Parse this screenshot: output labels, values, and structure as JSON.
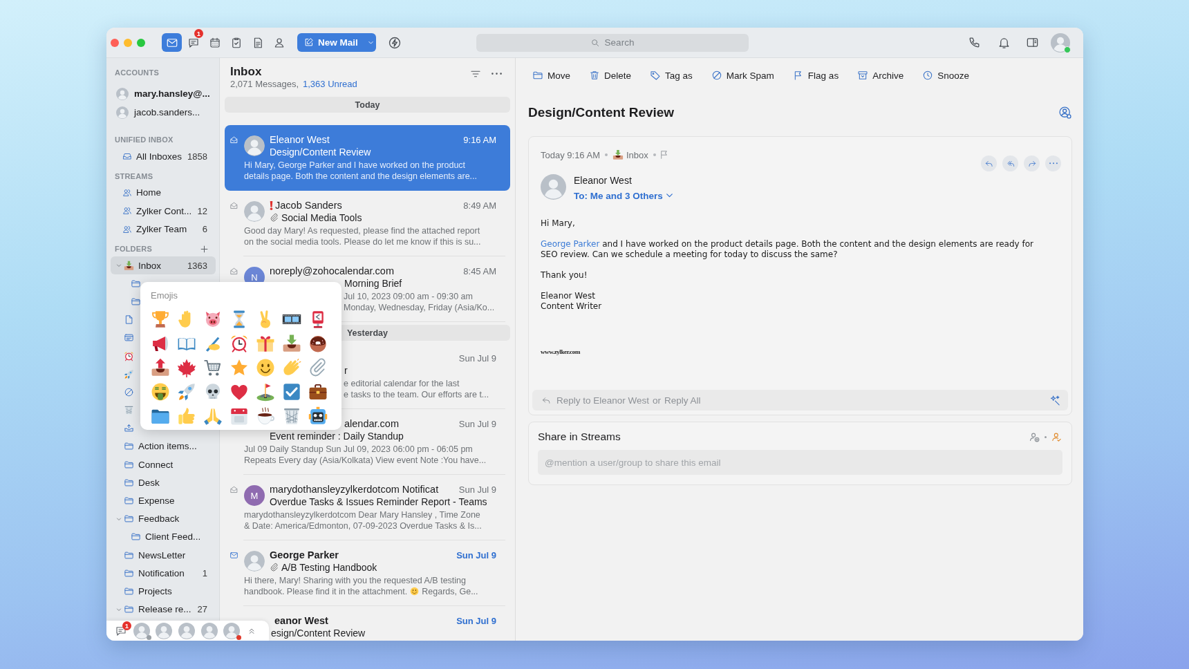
{
  "toolbar": {
    "apps": [
      {
        "kind": "mail",
        "selected": true
      },
      {
        "kind": "chat",
        "selected": false,
        "badge": "1"
      },
      {
        "kind": "calendar",
        "selected": false
      },
      {
        "kind": "tasks",
        "selected": false
      },
      {
        "kind": "notes",
        "selected": false
      },
      {
        "kind": "contacts",
        "selected": false
      }
    ],
    "new_mail": "New Mail",
    "search": {
      "placeholder": "Search"
    },
    "profile": {
      "color": "#35c759"
    }
  },
  "sidebar": {
    "sections": [
      {
        "title": "ACCOUNTS",
        "items": [
          {
            "kind": "account",
            "label": "mary.hansley@...",
            "primary": true,
            "selected": false
          },
          {
            "kind": "account",
            "label": "jacob.sanders...",
            "primary": false,
            "selected": false
          }
        ]
      },
      {
        "title": "UNIFIED INBOX",
        "items": [
          {
            "kind": "all_inboxes",
            "label": "All Inboxes",
            "count": "1858",
            "selected": false
          }
        ]
      },
      {
        "title": "STREAMS",
        "items": [
          {
            "kind": "stream",
            "label": "Home",
            "selected": false
          },
          {
            "kind": "stream",
            "label": "Zylker Cont...",
            "count": "12",
            "selected": false
          },
          {
            "kind": "stream",
            "label": "Zylker Team",
            "count": "6",
            "selected": false
          }
        ]
      },
      {
        "title": "FOLDERS",
        "add_button": true,
        "items": [
          {
            "kind": "inbox",
            "label": "Inbox",
            "count": "1363",
            "expanded": true,
            "selected": true,
            "children": [
              {
                "kind": "folder",
                "selected": false
              },
              {
                "kind": "folder",
                "selected": false
              }
            ]
          },
          {
            "kind": "drafts",
            "selected": false
          },
          {
            "kind": "templates",
            "selected": false
          },
          {
            "kind": "snoozed",
            "selected": false
          },
          {
            "kind": "sent",
            "selected": false
          },
          {
            "kind": "spam",
            "selected": false
          },
          {
            "kind": "trash",
            "selected": false
          },
          {
            "kind": "outbox",
            "selected": false
          },
          {
            "kind": "folder",
            "label": "Action items...",
            "selected": false
          },
          {
            "kind": "folder",
            "label": "Connect",
            "selected": false
          },
          {
            "kind": "folder",
            "label": "Desk",
            "selected": false
          },
          {
            "kind": "folder",
            "label": "Expense",
            "selected": false
          },
          {
            "kind": "folder",
            "label": "Feedback",
            "expanded": true,
            "selected": false,
            "children": [
              {
                "kind": "folder",
                "label": "Client Feed...",
                "selected": false
              }
            ]
          },
          {
            "kind": "folder",
            "label": "NewsLetter",
            "selected": false
          },
          {
            "kind": "folder",
            "label": "Notification",
            "count": "1",
            "selected": false
          },
          {
            "kind": "folder",
            "label": "Projects",
            "selected": false
          },
          {
            "kind": "folder",
            "label": "Release re...",
            "count": "27",
            "expanded": true,
            "selected": false
          }
        ]
      }
    ]
  },
  "message_list": {
    "title": "Inbox",
    "total": "2,071 Messages,",
    "unread": "1,363 Unread",
    "groups": [
      {
        "label": "Today",
        "messages": [
          {
            "selected": true,
            "unread": false,
            "avatar": {
              "kind": "photo"
            },
            "sender": "Eleanor West",
            "important": false,
            "time": "9:16 AM",
            "attachment": false,
            "subject": "Design/Content Review",
            "preview": [
              {
                "kind": "text",
                "text": "Hi Mary, George Parker and I have worked on the product\ndetails page. Both the content and the design elements are..."
              }
            ]
          },
          {
            "selected": false,
            "unread": false,
            "avatar": {
              "kind": "photo"
            },
            "sender": "Jacob Sanders",
            "important": true,
            "time": "8:49 AM",
            "attachment": true,
            "subject": "Social Media Tools",
            "preview": [
              {
                "kind": "text",
                "text": "Good day Mary! As requested, please find the attached report\non the social media tools. Please do let me know if this is su..."
              }
            ]
          },
          {
            "selected": false,
            "unread": false,
            "avatar": {
              "kind": "letter",
              "letter": "N",
              "color": "#6b86d6"
            },
            "sender": "noreply@zohocalendar.com",
            "important": false,
            "time": "8:45 AM",
            "attachment": false,
            "subject": {
              "kind": "behind_popup",
              "text": "Morning Brief"
            },
            "preview": [
              {
                "kind": "text_behind_popup",
                "text": "Jul 10, 2023 09:00 am - 09:30 am\nMonday, Wednesday, Friday (Asia/Ko..."
              }
            ]
          }
        ]
      },
      {
        "label": "Yesterday",
        "messages": [
          {
            "selected": false,
            "unread": false,
            "important": false,
            "time": "Sun Jul 9",
            "attachment": false,
            "subject": {
              "kind": "behind_popup",
              "text": "r"
            },
            "preview": [
              {
                "kind": "text_behind_popup",
                "text": "e editorial calendar for the last\ne tasks to the team. Our efforts are t..."
              }
            ]
          },
          {
            "selected": false,
            "unread": false,
            "sender": {
              "kind": "behind_popup",
              "text": "alendar.com"
            },
            "important": false,
            "time": "Sun Jul 9",
            "attachment": false,
            "subject": "Event reminder : Daily Standup",
            "preview": [
              {
                "kind": "text",
                "text": "Jul 09 Daily Standup Sun Jul 09, 2023 06:00 pm - 06:05 pm\nRepeats Every day (Asia/Kolkata) View event Note :You have..."
              }
            ]
          },
          {
            "selected": false,
            "unread": false,
            "avatar": {
              "kind": "letter",
              "letter": "M",
              "color": "#8f6bb0"
            },
            "sender": "marydothansleyzylkerdotcom Notificat",
            "important": false,
            "time": "Sun Jul 9",
            "attachment": false,
            "subject": "Overdue Tasks & Issues Reminder Report - Teams",
            "preview": [
              {
                "kind": "text",
                "text": "marydothansleyzylkerdotcom Dear Mary Hansley , Time Zone\n& Date: America/Edmonton, 07-09-2023 Overdue Tasks & Is..."
              }
            ]
          },
          {
            "selected": false,
            "unread": true,
            "avatar": {
              "kind": "photo"
            },
            "sender": "George Parker",
            "important": false,
            "time": "Sun Jul 9",
            "attachment": true,
            "subject": "A/B Testing Handbook",
            "preview": [
              {
                "kind": "text",
                "text": "Hi there, Mary! Sharing with you the requested A/B testing"
              },
              {
                "kind": "line_break"
              },
              {
                "kind": "text",
                "text": "handbook. Please find it in the attachment."
              },
              {
                "kind": "emoji"
              },
              {
                "kind": "text",
                "text": "Regards, Ge..."
              }
            ]
          },
          {
            "selected": false,
            "unread": true,
            "sender": {
              "kind": "behind_bar",
              "text": "eanor West"
            },
            "important": false,
            "time": "Sun Jul 9",
            "attachment": false,
            "subject": {
              "kind": "behind_bar",
              "text": "esign/Content Review"
            }
          }
        ]
      }
    ]
  },
  "reader": {
    "toolbar": [
      {
        "kind": "move",
        "label": "Move"
      },
      {
        "kind": "delete",
        "label": "Delete"
      },
      {
        "kind": "tag",
        "label": "Tag as"
      },
      {
        "kind": "spam",
        "label": "Mark Spam"
      },
      {
        "kind": "flag",
        "label": "Flag as"
      },
      {
        "kind": "archive",
        "label": "Archive"
      },
      {
        "kind": "snooze",
        "label": "Snooze"
      }
    ],
    "subject": "Design/Content Review",
    "message": {
      "date": "Today 9:16 AM",
      "folder": "Inbox",
      "flagged": false,
      "sender": "Eleanor West",
      "recipients": "To: Me and 3 Others",
      "body": [
        [
          {
            "kind": "text",
            "text": "Hi Mary,"
          }
        ],
        [
          {
            "kind": "link",
            "text": "George Parker"
          },
          {
            "kind": "text",
            "text": " and I have worked on the product details page. Both the content and the design elements are ready for\nSEO review. Can we schedule a meeting for today to discuss the same?"
          }
        ],
        [
          {
            "kind": "text",
            "text": "Thank you!"
          }
        ],
        [
          {
            "kind": "text",
            "text": "Eleanor West\nContent Writer"
          }
        ]
      ],
      "signature_logo": "www.zylker.com"
    },
    "reply_bar": {
      "reply": "Reply to Eleanor West",
      "separator": "or",
      "reply_all": "Reply All"
    },
    "share": {
      "title": "Share in Streams",
      "placeholder": "@mention a user/group to share this email"
    }
  },
  "emoji_picker": {
    "title": "Emojis"
  },
  "chat_bar": {
    "badge": "1",
    "people": [
      {
        "kind": "photo",
        "color": "#9aa0a6"
      },
      {
        "kind": "photo"
      },
      {
        "kind": "photo"
      },
      {
        "kind": "photo"
      },
      {
        "kind": "photo",
        "color": "#e0392b"
      }
    ]
  }
}
